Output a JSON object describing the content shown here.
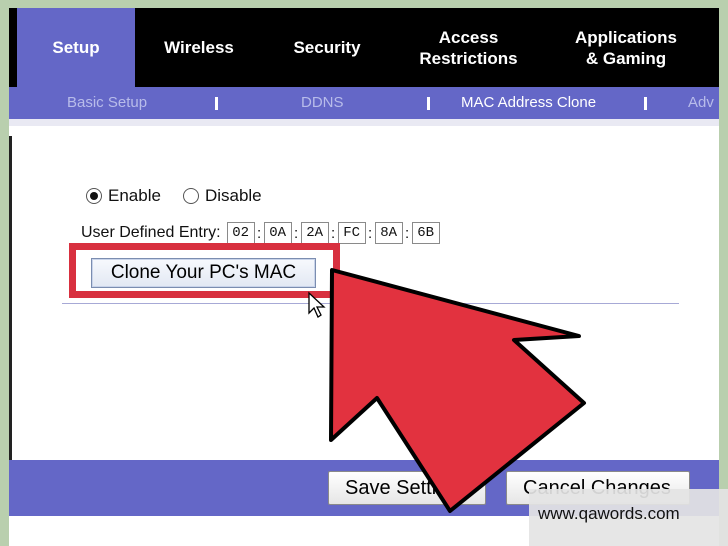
{
  "nav": {
    "tabs": [
      {
        "label": "Setup",
        "active": true
      },
      {
        "label": "Wireless",
        "active": false
      },
      {
        "label": "Security",
        "active": false
      },
      {
        "label": "Access\nRestrictions",
        "active": false
      },
      {
        "label": "Applications\n& Gaming",
        "active": false
      }
    ],
    "subtabs": [
      {
        "label": "Basic Setup",
        "active": false
      },
      {
        "label": "DDNS",
        "active": false
      },
      {
        "label": "MAC Address Clone",
        "active": true
      },
      {
        "label": "Adv",
        "active": false
      }
    ]
  },
  "clone": {
    "enable_label": "Enable",
    "disable_label": "Disable",
    "selected": "Enable",
    "entry_label": "User Defined Entry:",
    "mac_octets": [
      "02",
      "0A",
      "2A",
      "FC",
      "8A",
      "6B"
    ],
    "clone_button": "Clone Your PC's MAC"
  },
  "footer": {
    "save_label": "Save Settings",
    "cancel_label": "Cancel Changes"
  },
  "watermark": "www.qawords.com",
  "colors": {
    "nav_bg": "#000000",
    "nav_active": "#6467c7",
    "highlight": "#d8303f",
    "arrow": "#e2323f"
  }
}
